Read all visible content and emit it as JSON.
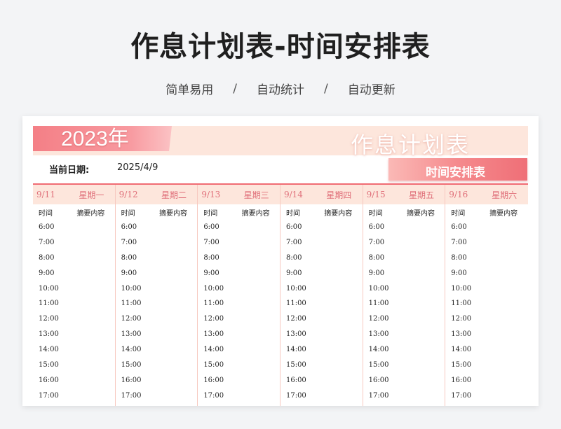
{
  "page": {
    "title": "作息计划表-时间安排表",
    "subtitle": [
      "简单易用",
      "自动统计",
      "自动更新"
    ],
    "separator": "/"
  },
  "sheet": {
    "year_label": "2023年",
    "banner_title": "作息计划表",
    "date_label": "当前日期:",
    "date_value": "2025/4/9",
    "schedule_label": "时间安排表",
    "col_time": "时间",
    "col_summary": "摘要内容",
    "days": [
      {
        "date": "9/11",
        "weekday": "星期一"
      },
      {
        "date": "9/12",
        "weekday": "星期二"
      },
      {
        "date": "9/13",
        "weekday": "星期三"
      },
      {
        "date": "9/14",
        "weekday": "星期四"
      },
      {
        "date": "9/15",
        "weekday": "星期五"
      },
      {
        "date": "9/16",
        "weekday": "星期六"
      }
    ],
    "times": [
      "6:00",
      "7:00",
      "8:00",
      "9:00",
      "10:00",
      "11:00",
      "12:00",
      "13:00",
      "14:00",
      "15:00",
      "16:00",
      "17:00"
    ]
  },
  "colors": {
    "accent": "#f06b73",
    "header_bg": "#fde6dc",
    "header_text": "#e0707a"
  }
}
